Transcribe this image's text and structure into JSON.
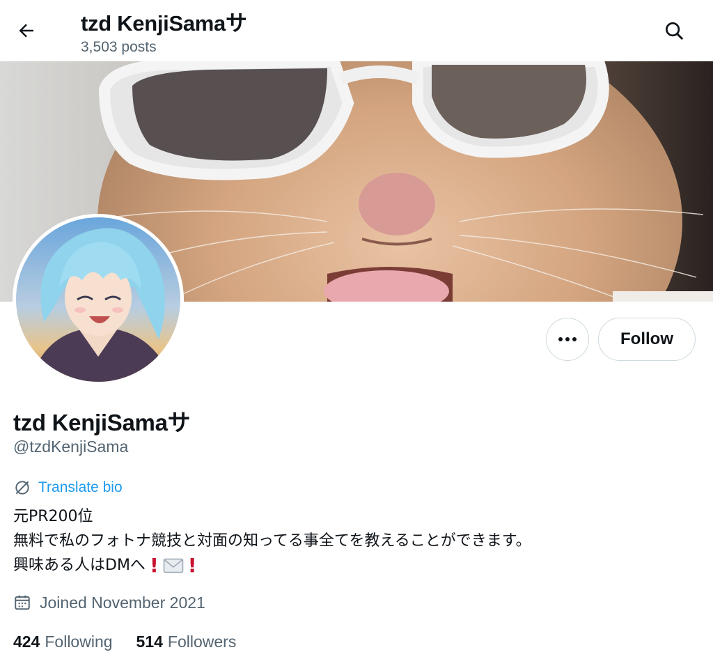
{
  "header": {
    "title": "tzd KenjiSamaサ",
    "posts_count": "3,503 posts"
  },
  "profile": {
    "display_name": "tzd KenjiSamaサ",
    "handle": "@tzdKenjiSama",
    "translate_label": "Translate bio",
    "bio_lines": [
      "元PR200位",
      "無料で私のフォトナ競技と対面の知ってる事全てを教えることができます。",
      "興味ある人はDMへ"
    ],
    "joined": "Joined November 2021",
    "following_count": "424",
    "following_label": "Following",
    "followers_count": "514",
    "followers_label": "Followers"
  },
  "actions": {
    "more_icon": "ellipsis-icon",
    "follow_label": "Follow"
  },
  "icons": {
    "back": "arrow-left-icon",
    "search": "search-icon",
    "translate": "globe-slash-icon",
    "calendar": "calendar-icon",
    "exclamation": "red-exclamation-emoji",
    "envelope": "envelope-emoji"
  },
  "colors": {
    "accent": "#1d9bf0",
    "text_primary": "#0f1419",
    "text_secondary": "#536471",
    "border": "#cfd9de"
  }
}
